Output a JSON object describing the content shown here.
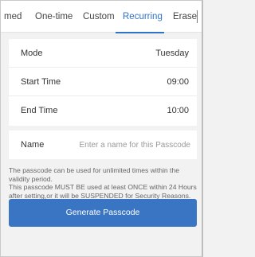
{
  "tabs": [
    {
      "label": "med"
    },
    {
      "label": "One-time"
    },
    {
      "label": "Custom"
    },
    {
      "label": "Recurring"
    },
    {
      "label": "Erase"
    }
  ],
  "active_tab": "Recurring",
  "schedule": {
    "mode_label": "Mode",
    "mode_value": "Tuesday",
    "start_label": "Start Time",
    "start_value": "09:00",
    "end_label": "End Time",
    "end_value": "10:00"
  },
  "name_field": {
    "label": "Name",
    "placeholder": "Enter a name for this Passcode",
    "value": ""
  },
  "info_text": {
    "line1": "The passcode can be used for unlimited times within the validity period.",
    "line2": "This passcode MUST BE used at least ONCE within 24 Hours after setting,or it will be SUSPENDED for Security Reasons."
  },
  "generate_button": {
    "label": "Generate Passcode"
  },
  "colors": {
    "accent": "#2f72c9",
    "button": "#3a75c4",
    "background": "#f2f2f2"
  }
}
